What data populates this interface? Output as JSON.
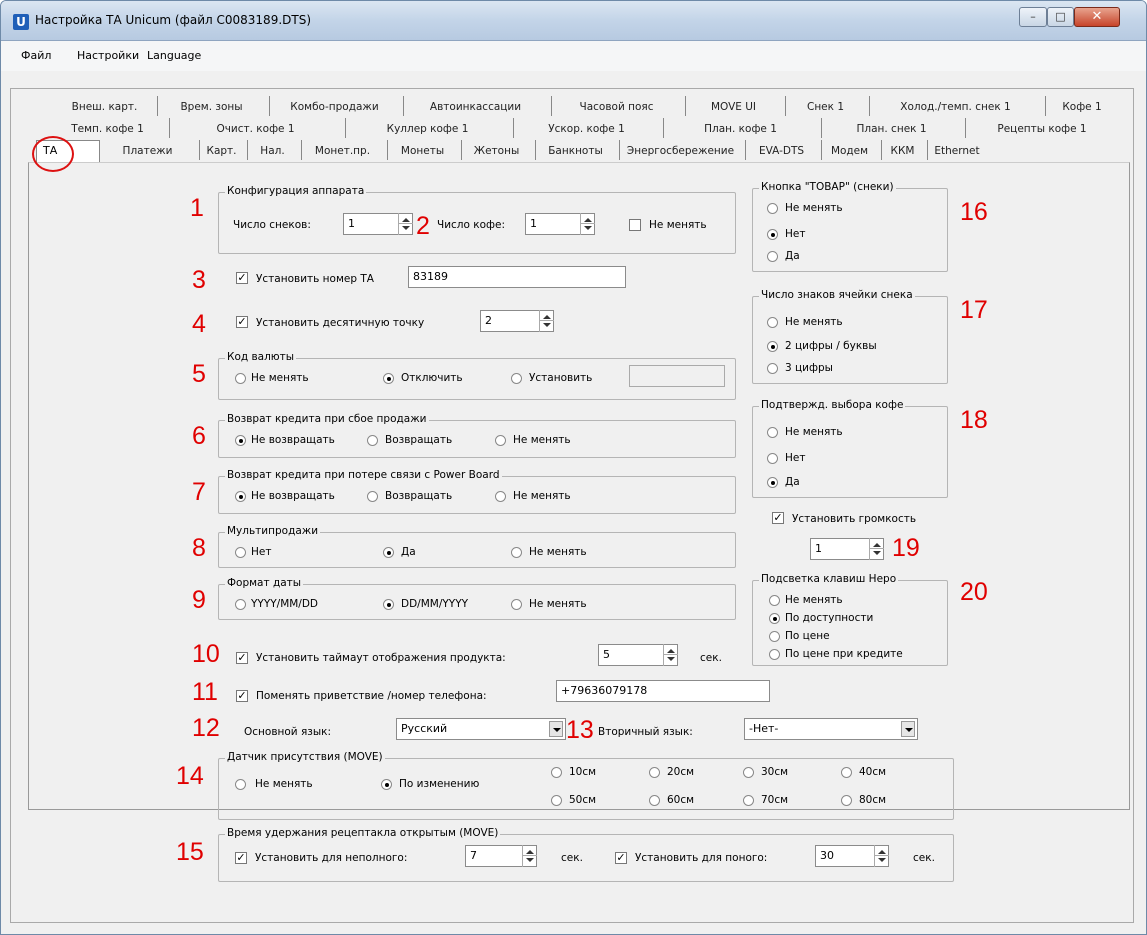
{
  "window": {
    "title": "Настройка ТА Unicum (файл C0083189.DTS)",
    "icon_letter": "U",
    "min": "–",
    "max": "□",
    "close": "✕"
  },
  "menu": [
    "Файл",
    "Настройки",
    "Language"
  ],
  "tabs_row1": [
    "Внеш. карт.",
    "Врем. зоны",
    "Комбо-продажи",
    "Автоинкассации",
    "Часовой пояс",
    "MOVE UI",
    "Снек 1",
    "Холод./темп. снек 1",
    "Кофе 1"
  ],
  "tabs_row2": [
    "Темп. кофе 1",
    "Очист. кофе 1",
    "Куллер кофе 1",
    "Ускор. кофе 1",
    "План. кофе 1",
    "План. снек 1",
    "Рецепты кофе 1"
  ],
  "tabs_row3": [
    "ТА",
    "Платежи",
    "Карт.",
    "Нал.",
    "Монет.пр.",
    "Монеты",
    "Жетоны",
    "Банкноты",
    "Энергосбережение",
    "EVA-DTS",
    "Модем",
    "ККМ",
    "Ethernet"
  ],
  "numbers": [
    "1",
    "2",
    "3",
    "4",
    "5",
    "6",
    "7",
    "8",
    "9",
    "10",
    "11",
    "12",
    "13",
    "14",
    "15",
    "16",
    "17",
    "18",
    "19",
    "20"
  ],
  "config": {
    "title": "Конфигурация аппарата",
    "snacks_label": "Число снеков:",
    "snacks_value": "1",
    "coffee_label": "Число кофе:",
    "coffee_value": "1",
    "no_change": "Не менять"
  },
  "ta_number": {
    "label": "Установить номер ТА",
    "value": "83189"
  },
  "decimal": {
    "label": "Установить десятичную точку",
    "value": "2"
  },
  "currency": {
    "title": "Код валюты",
    "opt1": "Не менять",
    "opt2": "Отключить",
    "opt3": "Установить",
    "value": ""
  },
  "refund_fail": {
    "title": "Возврат кредита при сбое продажи",
    "opt1": "Не возвращать",
    "opt2": "Возвращать",
    "opt3": "Не менять"
  },
  "refund_power": {
    "title": "Возврат кредита при потере связи с Power Board",
    "opt1": "Не возвращать",
    "opt2": "Возвращать",
    "opt3": "Не менять"
  },
  "multisale": {
    "title": "Мультипродажи",
    "opt1": "Нет",
    "opt2": "Да",
    "opt3": "Не менять"
  },
  "dateformat": {
    "title": "Формат даты",
    "opt1": "YYYY/MM/DD",
    "opt2": "DD/MM/YYYY",
    "opt3": "Не менять"
  },
  "timeout": {
    "label": "Установить таймаут отображения продукта:",
    "value": "5",
    "unit": "сек."
  },
  "greeting": {
    "label": "Поменять приветствие /номер телефона:",
    "value": "+79636079178"
  },
  "language": {
    "main_label": "Основной язык:",
    "main_value": "Русский",
    "second_label": "Вторичный язык:",
    "second_value": "-Нет-"
  },
  "presence": {
    "title": "Датчик присутствия (MOVE)",
    "opt_nochange": "Не менять",
    "opt_change": "По изменению",
    "d": [
      "10см",
      "20см",
      "30см",
      "40см",
      "50см",
      "60см",
      "70см",
      "80см"
    ]
  },
  "hold": {
    "title": "Время удержания рецептакла открытым (MOVE)",
    "partial_label": "Установить для неполного:",
    "partial_value": "7",
    "full_label": "Установить для поного:",
    "full_value": "30",
    "unit": "сек."
  },
  "product_btn": {
    "title": "Кнопка \"ТОВАР\" (снеки)",
    "opt1": "Не менять",
    "opt2": "Нет",
    "opt3": "Да"
  },
  "cell_digits": {
    "title": "Число знаков ячейки снека",
    "opt1": "Не менять",
    "opt2": "2 цифры / буквы",
    "opt3": "3 цифры"
  },
  "confirm_coffee": {
    "title": "Подтвержд. выбора кофе",
    "opt1": "Не менять",
    "opt2": "Нет",
    "opt3": "Да"
  },
  "volume": {
    "label": "Установить громкость",
    "value": "1"
  },
  "backlight": {
    "title": "Подсветка клавиш Неро",
    "opt1": "Не менять",
    "opt2": "По доступности",
    "opt3": "По цене",
    "opt4": "По цене при кредите"
  },
  "check_mark": "✓",
  "accent_red": "#e00000"
}
